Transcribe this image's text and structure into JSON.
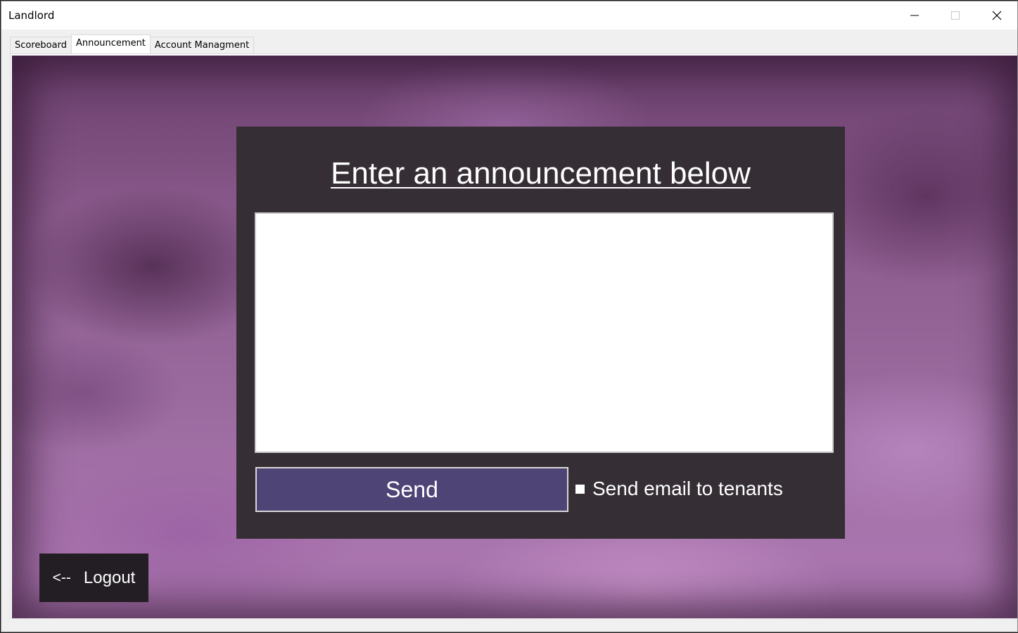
{
  "window": {
    "title": "Landlord",
    "controls": {
      "minimize": "minimize-icon",
      "maximize": "maximize-icon",
      "close": "close-icon"
    }
  },
  "tabs": [
    {
      "label": "Scoreboard",
      "active": false
    },
    {
      "label": "Announcement",
      "active": true
    },
    {
      "label": "Account Managment",
      "active": false
    }
  ],
  "announcement": {
    "heading": "Enter an announcement below",
    "message_value": "",
    "send_label": "Send",
    "email_checkbox_label": "Send email to tenants",
    "email_checked": false
  },
  "logout": {
    "arrow": "<--",
    "label": "Logout"
  },
  "colors": {
    "panel_bg": "#352e34",
    "send_button_bg": "#4f4476",
    "logout_bg": "#231e24",
    "background_purple": "#8b5b8d"
  }
}
